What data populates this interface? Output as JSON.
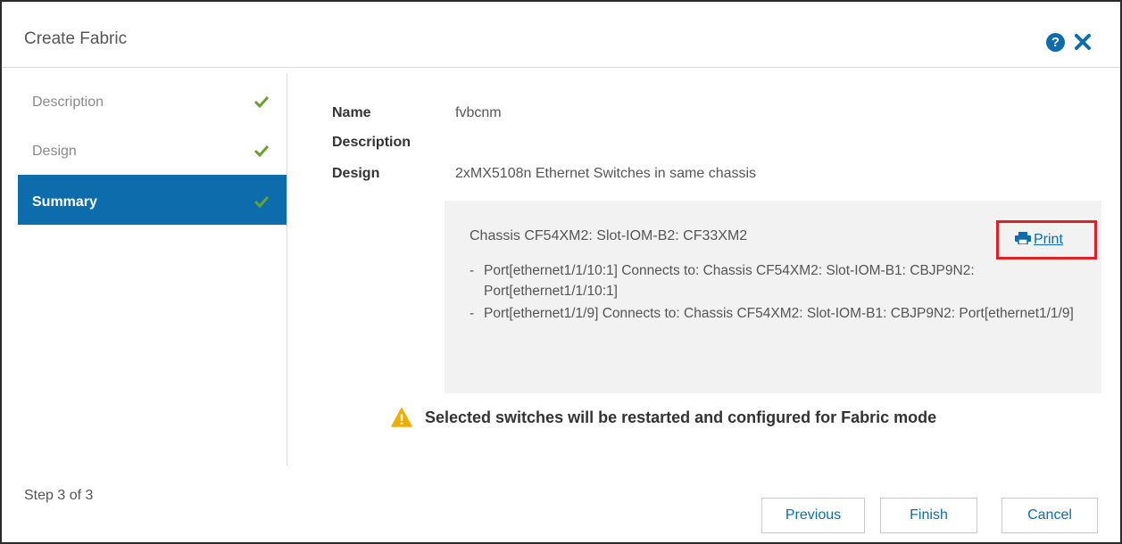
{
  "dialog": {
    "title": "Create Fabric",
    "help_icon": "?"
  },
  "steps": [
    {
      "label": "Description",
      "icon": "checkmark-icon",
      "state": "completed"
    },
    {
      "label": "Design",
      "icon": "checkmark-icon",
      "state": "completed"
    },
    {
      "label": "Summary",
      "icon": "checkmark-icon",
      "state": "active"
    }
  ],
  "summary": {
    "name_label": "Name",
    "name_value": "fvbcnm",
    "description_label": "Description",
    "description_value": "",
    "design_label": "Design",
    "design_value": "2xMX5108n Ethernet Switches in same chassis"
  },
  "connections": {
    "chassis_line": "Chassis CF54XM2: Slot-IOM-B2: CF33XM2",
    "items": [
      "Port[ethernet1/1/10:1] Connects to: Chassis CF54XM2: Slot-IOM-B1: CBJP9N2: Port[ethernet1/1/10:1]",
      "Port[ethernet1/1/9] Connects to: Chassis CF54XM2: Slot-IOM-B1: CBJP9N2: Port[ethernet1/1/9]"
    ],
    "print_label": "Print"
  },
  "warning": {
    "text": "Selected switches will be restarted and configured for Fabric mode"
  },
  "footer": {
    "step_counter": "Step 3 of 3",
    "previous_label": "Previous",
    "finish_label": "Finish",
    "cancel_label": "Cancel"
  },
  "colors": {
    "accent": "#0d6cab",
    "success": "#6aa12a",
    "warning": "#f0ad00",
    "highlight": "#e02027"
  }
}
